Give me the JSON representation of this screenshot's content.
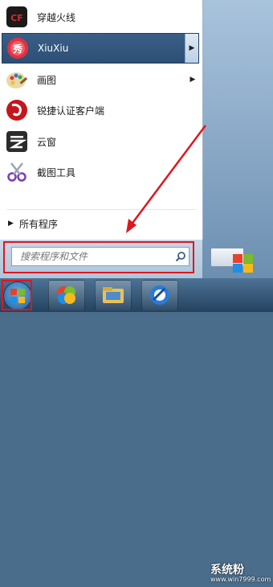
{
  "programs": [
    {
      "label": "穿越火线",
      "icon": "crossfire-icon",
      "has_submenu": false
    },
    {
      "label": "XiuXiu",
      "icon": "xiuxiu-icon",
      "has_submenu": true,
      "selected": true
    },
    {
      "label": "画图",
      "icon": "paint-icon",
      "has_submenu": true
    },
    {
      "label": "锐捷认证客户端",
      "icon": "ruijie-icon",
      "has_submenu": false
    },
    {
      "label": "云窗",
      "icon": "yunchuang-icon",
      "has_submenu": false
    },
    {
      "label": "截图工具",
      "icon": "snipping-tool-icon",
      "has_submenu": false
    }
  ],
  "all_programs_label": "所有程序",
  "search": {
    "placeholder": "搜索程序和文件"
  },
  "watermark": {
    "text": "系统粉",
    "url": "www.win7999.com"
  },
  "colors": {
    "highlight": "#e0161d",
    "selected_bg": "#2d4f75"
  }
}
